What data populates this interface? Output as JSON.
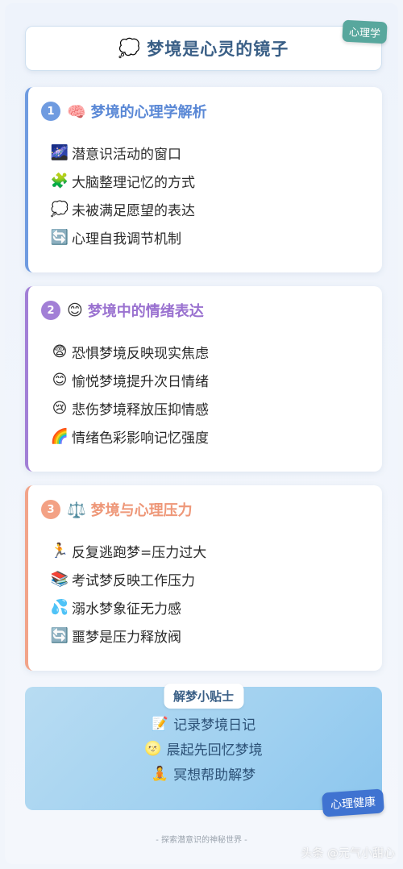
{
  "header": {
    "emoji": "💭",
    "title": "梦境是心灵的镜子",
    "tag": "心理学"
  },
  "sections": [
    {
      "number": "1",
      "emoji": "🧠",
      "title": "梦境的心理学解析",
      "items": [
        {
          "icon": "🌌",
          "text": "潜意识活动的窗口"
        },
        {
          "icon": "🧩",
          "text": "大脑整理记忆的方式"
        },
        {
          "icon": "💭",
          "text": "未被满足愿望的表达"
        },
        {
          "icon": "🔄",
          "text": "心理自我调节机制"
        }
      ]
    },
    {
      "number": "2",
      "emoji": "😊",
      "title": "梦境中的情绪表达",
      "items": [
        {
          "icon": "😨",
          "text": "恐惧梦境反映现实焦虑"
        },
        {
          "icon": "😊",
          "text": "愉悦梦境提升次日情绪"
        },
        {
          "icon": "😢",
          "text": "悲伤梦境释放压抑情感"
        },
        {
          "icon": "🌈",
          "text": "情绪色彩影响记忆强度"
        }
      ]
    },
    {
      "number": "3",
      "emoji": "⚖️",
      "title": "梦境与心理压力",
      "items": [
        {
          "icon": "🏃",
          "text": "反复逃跑梦=压力过大"
        },
        {
          "icon": "📚",
          "text": "考试梦反映工作压力"
        },
        {
          "icon": "💦",
          "text": "溺水梦象征无力感"
        },
        {
          "icon": "🔄",
          "text": "噩梦是压力释放阀"
        }
      ]
    }
  ],
  "tips": {
    "title": "解梦小贴士",
    "items": [
      {
        "icon": "📝",
        "text": "记录梦境日记"
      },
      {
        "icon": "🌝",
        "text": "晨起先回忆梦境"
      },
      {
        "icon": "🧘",
        "text": "冥想帮助解梦"
      }
    ],
    "tag": "心理健康"
  },
  "footer": "- 探索潜意识的神秘世界 -",
  "watermark": "头条 @元气小甜心"
}
